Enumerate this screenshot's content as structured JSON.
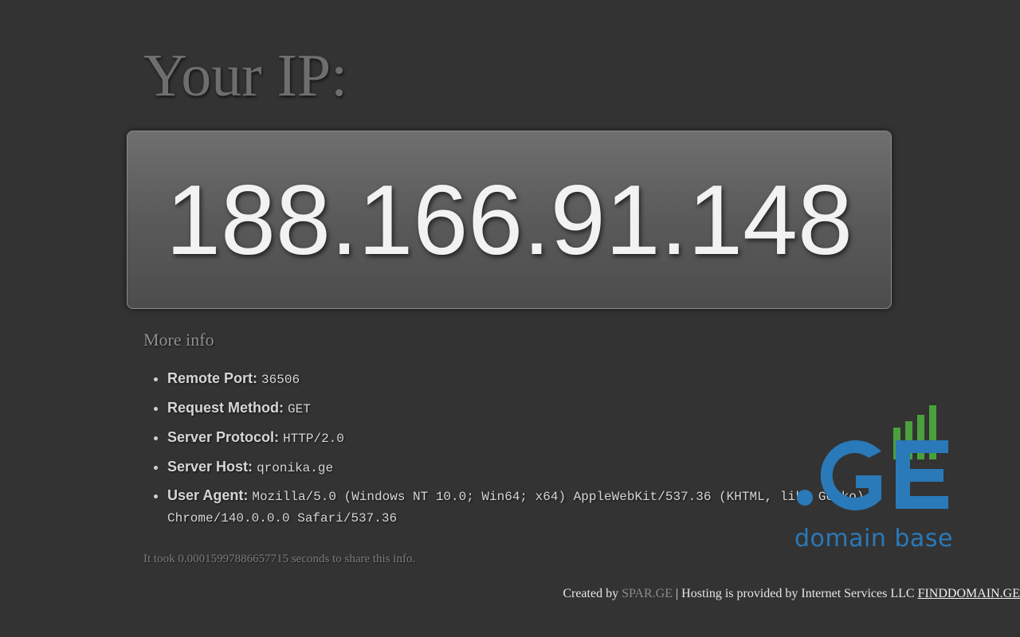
{
  "heading": "Your IP:",
  "ip_address": "188.166.91.148",
  "more_info": {
    "title": "More info",
    "items": [
      {
        "label": "Remote Port:",
        "value": "36506"
      },
      {
        "label": "Request Method:",
        "value": "GET"
      },
      {
        "label": "Server Protocol:",
        "value": "HTTP/2.0"
      },
      {
        "label": "Server Host:",
        "value": "qronika.ge"
      },
      {
        "label": "User Agent:",
        "value": "Mozilla/5.0 (Windows NT 10.0; Win64; x64) AppleWebKit/537.36 (KHTML, like Gecko) Chrome/140.0.0.0 Safari/537.36"
      }
    ]
  },
  "timing_text": "It took 0.00015997886657715 seconds to share this info.",
  "footer": {
    "created_by": "Created by",
    "spar_link": "SPAR.GE",
    "hosting_text": "| Hosting is provided by Internet Services LLC",
    "finddomain_link": "FINDDOMAIN.GE"
  },
  "logo": {
    "mark": ".GE",
    "caption": "domain base",
    "colors": {
      "blue": "#2a79b8",
      "green": "#4aa03c"
    }
  },
  "colors": {
    "background": "#333333",
    "heading": "#6e6e6e",
    "ip_text": "#f2f2f2"
  }
}
